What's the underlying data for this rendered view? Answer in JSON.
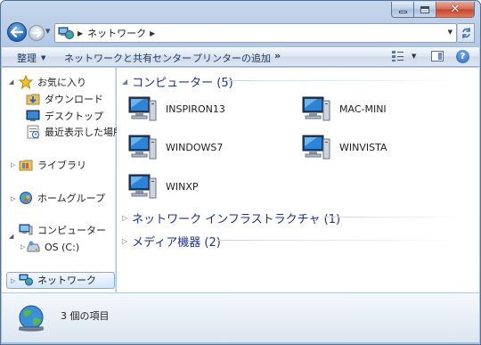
{
  "window": {
    "caption_icons": [
      "minimize-icon",
      "maximize-icon",
      "close-icon"
    ]
  },
  "address_bar": {
    "icon": "network-icon",
    "crumbs": [
      "ネットワーク"
    ]
  },
  "command_bar": {
    "organize": "整理",
    "network_sharing_center": "ネットワークと共有センター",
    "add_printer": "プリンターの追加",
    "more": "»"
  },
  "navigation": {
    "favorites": {
      "label": "お気に入り",
      "icon": "star-icon"
    },
    "favorites_items": [
      {
        "label": "ダウンロード",
        "icon": "download-folder-icon"
      },
      {
        "label": "デスクトップ",
        "icon": "desktop-icon"
      },
      {
        "label": "最近表示した場所",
        "icon": "recent-places-icon"
      }
    ],
    "libraries": {
      "label": "ライブラリ",
      "icon": "library-icon"
    },
    "homegroup": {
      "label": "ホームグループ",
      "icon": "homegroup-icon"
    },
    "computer": {
      "label": "コンピューター",
      "icon": "computer-icon"
    },
    "computer_items": [
      {
        "label": "OS (C:)",
        "icon": "drive-icon"
      }
    ],
    "network": {
      "label": "ネットワーク",
      "icon": "network-icon"
    }
  },
  "content": {
    "groups": [
      {
        "title": "コンピューター (5)",
        "expanded": true,
        "items": [
          "INSPIRON13",
          "MAC-MINI",
          "WINDOWS7",
          "WINVISTA",
          "WINXP"
        ]
      },
      {
        "title": "ネットワーク インフラストラクチャ (1)",
        "expanded": false
      },
      {
        "title": "メディア機器 (2)",
        "expanded": false
      }
    ]
  },
  "details": {
    "text": "3 個の項目",
    "icon": "network-globe-icon"
  }
}
